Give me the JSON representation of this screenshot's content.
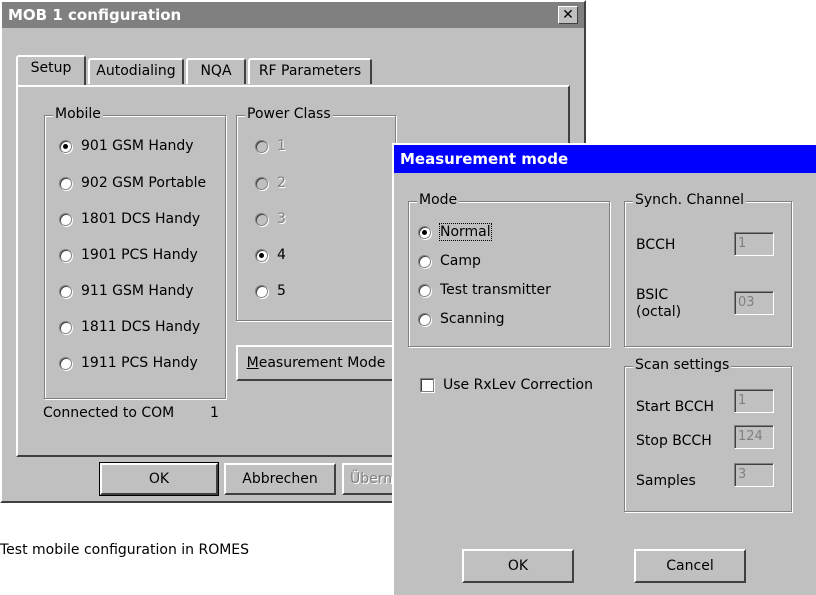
{
  "caption": "Test mobile configuration in ROMES",
  "back_window": {
    "title": "MOB 1 configuration",
    "close_label": "✕",
    "tabs": [
      {
        "label": "Setup",
        "active": true
      },
      {
        "label": "Autodialing",
        "active": false
      },
      {
        "label": "NQA",
        "active": false
      },
      {
        "label": "RF Parameters",
        "active": false
      }
    ],
    "mobile_group": {
      "legend": "Mobile",
      "options": [
        {
          "label": "901 GSM Handy",
          "checked": true
        },
        {
          "label": "902 GSM Portable",
          "checked": false
        },
        {
          "label": "1801 DCS Handy",
          "checked": false
        },
        {
          "label": "1901 PCS Handy",
          "checked": false
        },
        {
          "label": "911 GSM Handy",
          "checked": false
        },
        {
          "label": "1811 DCS Handy",
          "checked": false
        },
        {
          "label": "1911 PCS Handy",
          "checked": false
        }
      ]
    },
    "power_class_group": {
      "legend": "Power Class",
      "options": [
        {
          "label": "1",
          "checked": false,
          "disabled": true
        },
        {
          "label": "2",
          "checked": false,
          "disabled": true
        },
        {
          "label": "3",
          "checked": false,
          "disabled": true
        },
        {
          "label": "4",
          "checked": true,
          "disabled": false
        },
        {
          "label": "5",
          "checked": false,
          "disabled": false
        }
      ]
    },
    "measurement_mode_button": {
      "first_letter": "M",
      "rest": "easurement Mode"
    },
    "connected_label": "Connected to COM",
    "connected_port": "1",
    "ok_label": "OK",
    "cancel_label": "Abbrechen",
    "apply_label_visible": "Übern"
  },
  "front_window": {
    "title": "Measurement mode",
    "mode_group": {
      "legend": "Mode",
      "options": [
        {
          "label": "Normal",
          "checked": true
        },
        {
          "label": "Camp",
          "checked": false
        },
        {
          "label": "Test transmitter",
          "checked": false
        },
        {
          "label": "Scanning",
          "checked": false
        }
      ]
    },
    "sync_group": {
      "legend": "Synch. Channel",
      "bcch_label": "BCCH",
      "bcch_value": "1",
      "bsic_label_line1": "BSIC",
      "bsic_label_line2": "(octal)",
      "bsic_value": "03"
    },
    "use_rxlev_label": "Use RxLev Correction",
    "use_rxlev_checked": false,
    "scan_group": {
      "legend": "Scan settings",
      "start_label": "Start BCCH",
      "start_value": "1",
      "stop_label": "Stop BCCH",
      "stop_value": "124",
      "samples_label": "Samples",
      "samples_value": "3"
    },
    "ok_label": "OK",
    "cancel_label": "Cancel"
  },
  "colors": {
    "titlebar_active": "#0000ff",
    "titlebar_inactive": "#808080",
    "face": "#c0c0c0"
  }
}
